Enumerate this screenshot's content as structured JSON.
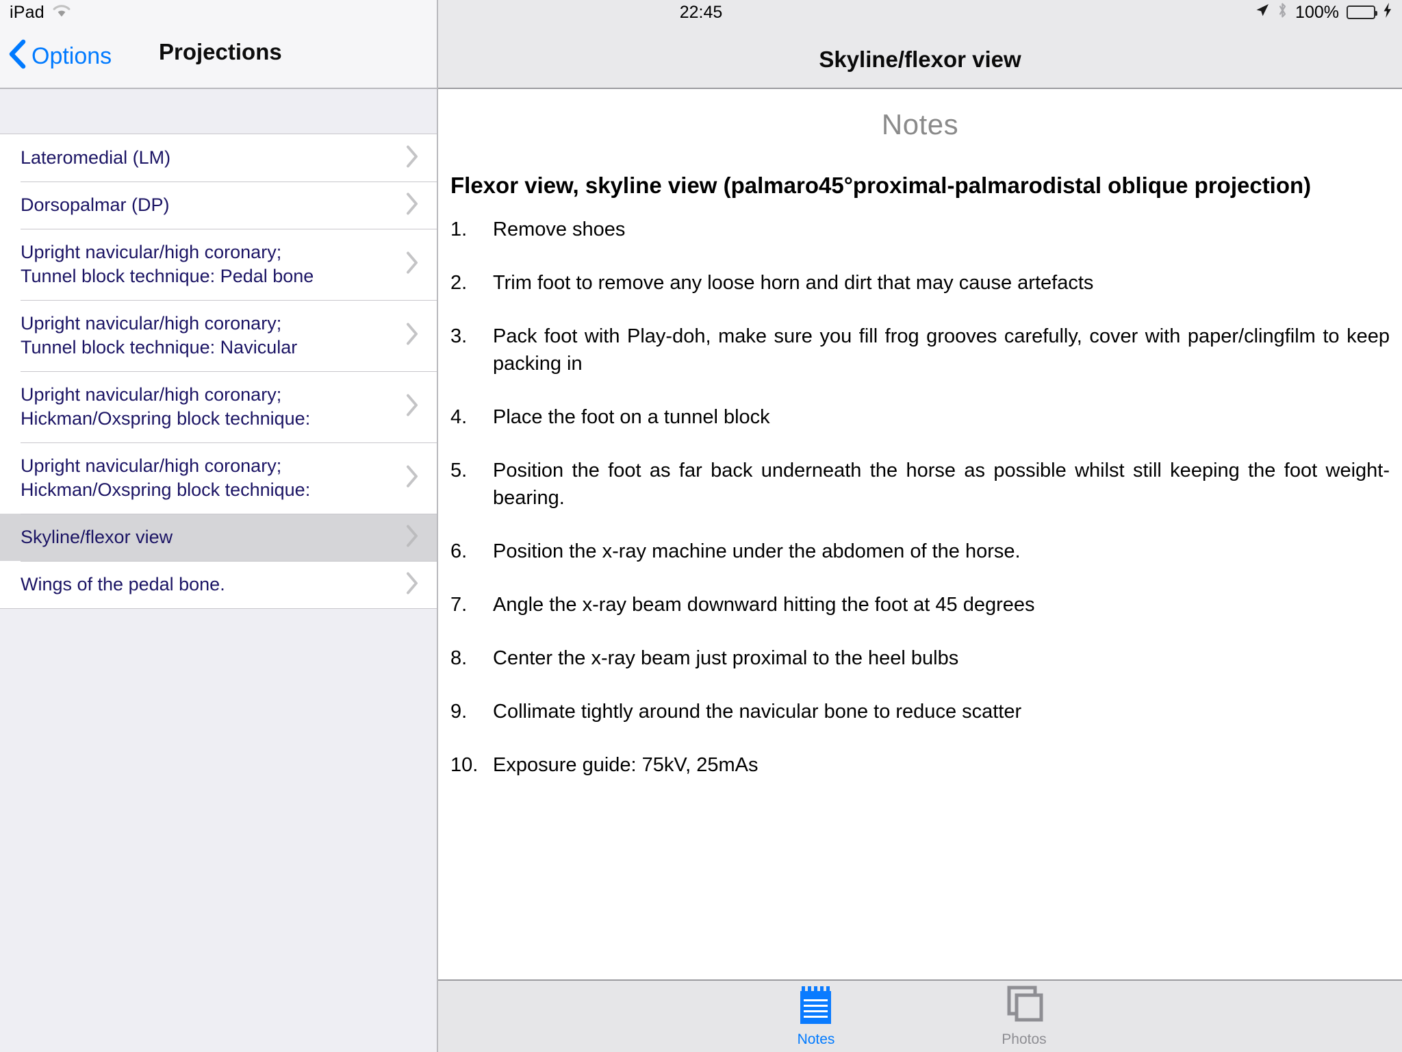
{
  "status_bar": {
    "device": "iPad",
    "wifi_icon": "wifi-icon",
    "time": "22:45",
    "location_icon": "location-arrow-icon",
    "bluetooth_icon": "bluetooth-icon",
    "battery_percent": "100%",
    "battery_icon": "battery-full-icon",
    "charging_icon": "lightning-bolt-icon",
    "battery_color": "#4cd964"
  },
  "master": {
    "back_label": "Options",
    "back_icon": "chevron-left-icon",
    "title": "Projections",
    "accent_color": "#007aff",
    "row_text_color": "#1b1464",
    "selected_row_color": "#d5d5d8",
    "rows": [
      {
        "label": "Lateromedial (LM)",
        "selected": false
      },
      {
        "label": "Dorsopalmar (DP)",
        "selected": false
      },
      {
        "label": "Upright navicular/high coronary;\nTunnel block technique: Pedal bone",
        "selected": false
      },
      {
        "label": "Upright navicular/high coronary;\nTunnel block technique: Navicular",
        "selected": false
      },
      {
        "label": "Upright navicular/high coronary;\nHickman/Oxspring block technique:",
        "selected": false
      },
      {
        "label": "Upright navicular/high coronary;\nHickman/Oxspring block technique:",
        "selected": false
      },
      {
        "label": "Skyline/flexor view",
        "selected": true
      },
      {
        "label": "Wings of the pedal bone.",
        "selected": false
      }
    ]
  },
  "detail": {
    "title": "Skyline/flexor view",
    "section_heading": "Notes",
    "document_title": "Flexor view, skyline view (palmaro45°proximal-palmarodistal oblique projection)",
    "steps": [
      "Remove shoes",
      "Trim foot to remove any loose horn and dirt that may cause artefacts",
      "Pack foot with Play-doh, make sure you fill frog grooves carefully, cover with paper/clingfilm to keep packing in",
      "Place the foot on a tunnel block",
      "Position the foot as far back underneath the horse as possible whilst still keeping the foot weight-bearing.",
      "Position the x-ray machine under the abdomen of the horse.",
      "Angle the x-ray beam downward hitting the foot at 45 degrees",
      "Center the x-ray beam just proximal to the heel bulbs",
      "Collimate tightly around the navicular bone to reduce scatter",
      "Exposure guide: 75kV, 25mAs"
    ]
  },
  "tabbar": {
    "tabs": [
      {
        "label": "Notes",
        "icon": "notepad-icon",
        "active": true,
        "color": "#007aff"
      },
      {
        "label": "Photos",
        "icon": "photos-stack-icon",
        "active": false,
        "color": "#8e8e93"
      }
    ]
  }
}
